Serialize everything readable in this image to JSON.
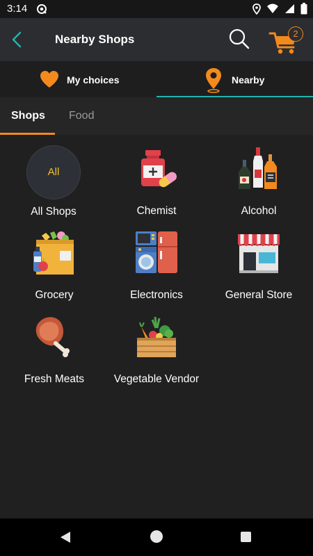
{
  "status_bar": {
    "time": "3:14"
  },
  "app_bar": {
    "title": "Nearby Shops",
    "cart_count": "2"
  },
  "mode_tabs": [
    {
      "label": "My choices",
      "icon": "heart-icon",
      "active": false
    },
    {
      "label": "Nearby",
      "icon": "location-pin-icon",
      "active": true
    }
  ],
  "sub_tabs": [
    {
      "label": "Shops",
      "active": true
    },
    {
      "label": "Food",
      "active": false
    }
  ],
  "categories": [
    {
      "label": "All Shops",
      "icon": "all-badge",
      "badge_text": "All"
    },
    {
      "label": "Chemist",
      "icon": "medicine-icon"
    },
    {
      "label": "Alcohol",
      "icon": "bottles-icon"
    },
    {
      "label": "Grocery",
      "icon": "grocery-bag-icon"
    },
    {
      "label": "Electronics",
      "icon": "appliances-icon"
    },
    {
      "label": "General Store",
      "icon": "storefront-icon"
    },
    {
      "label": "Fresh Meats",
      "icon": "meat-icon"
    },
    {
      "label": "Vegetable Vendor",
      "icon": "vegetable-crate-icon"
    }
  ],
  "colors": {
    "accent_orange": "#f28a1e",
    "accent_teal": "#1fb5ad",
    "background": "#202020",
    "app_bar": "#2c2d30"
  }
}
